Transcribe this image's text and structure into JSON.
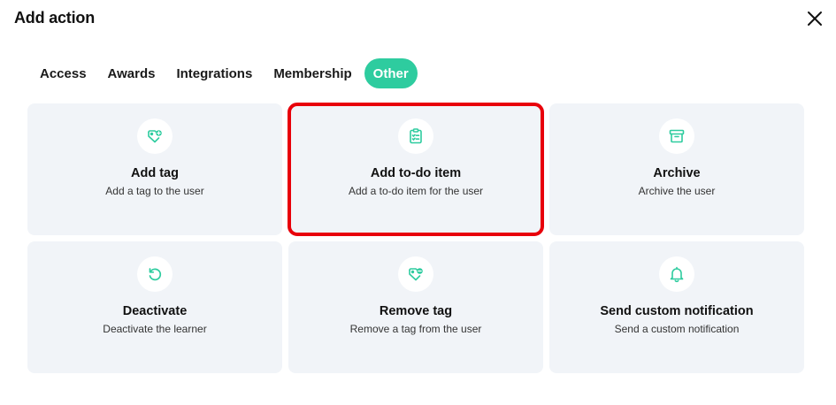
{
  "modal": {
    "title": "Add action"
  },
  "tabs": [
    {
      "label": "Access"
    },
    {
      "label": "Awards"
    },
    {
      "label": "Integrations"
    },
    {
      "label": "Membership"
    },
    {
      "label": "Other",
      "active": true
    }
  ],
  "colors": {
    "accent": "#2ecc9f",
    "card_bg": "#f1f4f8",
    "selection": "#e8000a"
  },
  "actions": [
    {
      "icon": "tag-add-icon",
      "title": "Add tag",
      "description": "Add a tag to the user"
    },
    {
      "icon": "clipboard-checklist-icon",
      "title": "Add to-do item",
      "description": "Add a to-do item for the user",
      "selected": true
    },
    {
      "icon": "archive-box-icon",
      "title": "Archive",
      "description": "Archive the user"
    },
    {
      "icon": "undo-circle-icon",
      "title": "Deactivate",
      "description": "Deactivate the learner"
    },
    {
      "icon": "tag-remove-icon",
      "title": "Remove tag",
      "description": "Remove a tag from the user"
    },
    {
      "icon": "bell-icon",
      "title": "Send custom notification",
      "description": "Send a custom notification"
    }
  ]
}
